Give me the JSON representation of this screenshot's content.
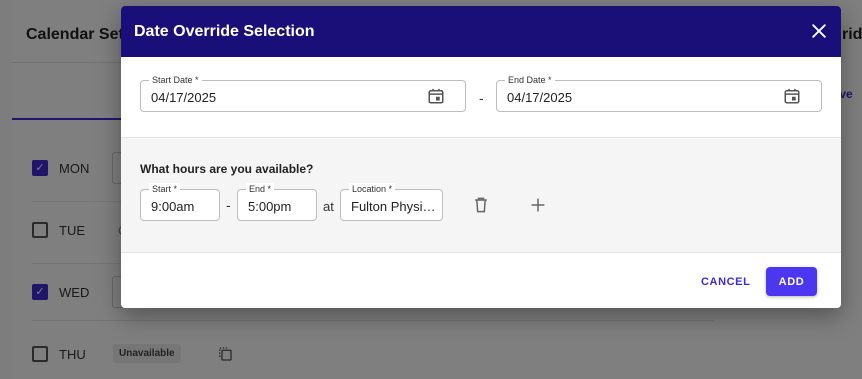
{
  "background": {
    "title": "Calendar Setti",
    "right_title": "rid",
    "right_tab": "ove",
    "days": [
      {
        "label": "MON",
        "checked": true
      },
      {
        "label": "TUE",
        "checked": false
      },
      {
        "label": "WED",
        "checked": true
      },
      {
        "label": "THU",
        "checked": false
      }
    ],
    "tue_partial": "C",
    "unavailable_badge": "Unavailable"
  },
  "dialog": {
    "title": "Date Override Selection",
    "start_date": {
      "label": "Start Date *",
      "value": "04/17/2025"
    },
    "date_separator": "-",
    "end_date": {
      "label": "End Date *",
      "value": "04/17/2025"
    },
    "hours_question": "What hours are you available?",
    "start_time": {
      "label": "Start *",
      "value": "9:00am"
    },
    "time_separator": "-",
    "end_time": {
      "label": "End *",
      "value": "5:00pm"
    },
    "at_text": "at",
    "location": {
      "label": "Location *",
      "value": "Fulton Physi…"
    },
    "cancel_label": "CANCEL",
    "add_label": "ADD"
  },
  "colors": {
    "header_bg": "#1a0f78",
    "accent": "#4d36f0",
    "link": "#3f2bd6"
  }
}
